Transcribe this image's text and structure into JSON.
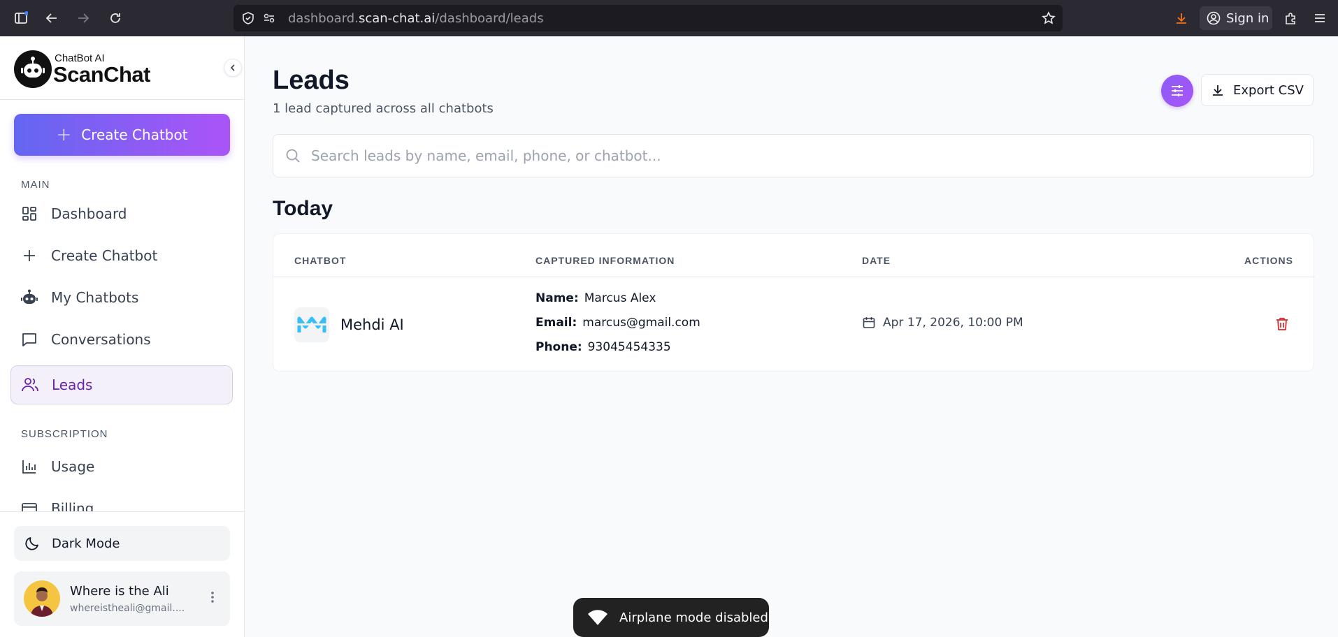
{
  "browser": {
    "url_prefix": "dashboard.",
    "url_host": "scan-chat.ai",
    "url_path": "/dashboard/leads",
    "signin_label": "Sign in"
  },
  "sidebar": {
    "logo_small": "ChatBot AI",
    "logo_big": "ScanChat",
    "create_button": "Create Chatbot",
    "main_section": "MAIN",
    "main_items": [
      {
        "label": "Dashboard",
        "icon": "grid-icon"
      },
      {
        "label": "Create Chatbot",
        "icon": "plus-icon"
      },
      {
        "label": "My Chatbots",
        "icon": "robot-icon"
      },
      {
        "label": "Conversations",
        "icon": "chat-icon"
      },
      {
        "label": "Leads",
        "icon": "users-icon",
        "active": true
      }
    ],
    "subscription_section": "SUBSCRIPTION",
    "subscription_items": [
      {
        "label": "Usage",
        "icon": "bar-chart-icon"
      },
      {
        "label": "Billing",
        "icon": "card-icon"
      }
    ],
    "dark_mode_label": "Dark Mode",
    "user": {
      "name": "Where is the Ali",
      "email": "whereistheali@gmail...."
    }
  },
  "main": {
    "title": "Leads",
    "subtitle": "1 lead captured across all chatbots",
    "export_label": "Export CSV",
    "search_placeholder": "Search leads by name, email, phone, or chatbot...",
    "group_title": "Today",
    "table": {
      "headers": [
        "CHATBOT",
        "CAPTURED INFORMATION",
        "DATE",
        "ACTIONS"
      ],
      "rows": [
        {
          "chatbot": "Mehdi AI",
          "name_label": "Name:",
          "name": "Marcus Alex",
          "email_label": "Email:",
          "email": "marcus@gmail.com",
          "phone_label": "Phone:",
          "phone": "93045454335",
          "date": "Apr 17, 2026, 10:00 PM"
        }
      ]
    }
  },
  "toast": {
    "message": "Airplane mode disabled"
  },
  "colors": {
    "accent_start": "#6366f1",
    "accent_end": "#a855f7",
    "active_nav_text": "#6b21a8",
    "delete_red": "#dc2626"
  }
}
